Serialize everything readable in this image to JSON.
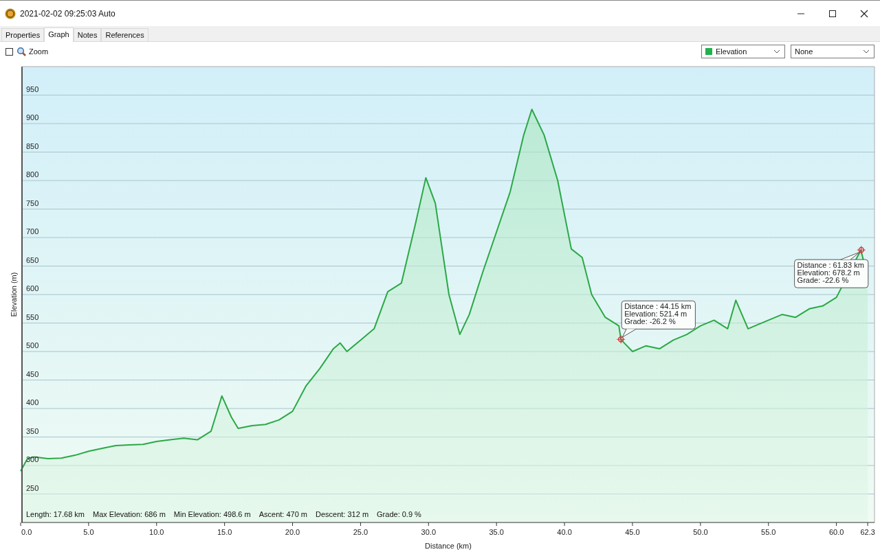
{
  "window": {
    "title": "2021-02-02 09:25:03 Auto"
  },
  "tabs": [
    {
      "label": "Properties",
      "selected": false
    },
    {
      "label": "Graph",
      "selected": true
    },
    {
      "label": "Notes",
      "selected": false
    },
    {
      "label": "References",
      "selected": false
    }
  ],
  "toolbar": {
    "zoom": {
      "label": "Zoom",
      "checked": false
    },
    "dropdowns": [
      {
        "value": "Elevation",
        "color": "#22b14c"
      },
      {
        "value": "None"
      }
    ]
  },
  "graph": {
    "stats": [
      "Length: 17.68 km",
      "Max Elevation: 686 m",
      "Min Elevation: 498.6 m",
      "Ascent: 470 m",
      "Descent: 312 m",
      "Grade: 0.9 %"
    ],
    "chart_data": {
      "type": "area",
      "xlabel": "Distance (km)",
      "ylabel": "Elevation (m)",
      "ylim": [
        200,
        1000
      ],
      "grid": true,
      "xlim": [
        0,
        62.8
      ],
      "xticks": [
        {
          "value": 0,
          "label": "0.0"
        },
        {
          "value": 5,
          "label": "5.0"
        },
        {
          "value": 10,
          "label": "10.0"
        },
        {
          "value": 15,
          "label": "15.0"
        },
        {
          "value": 20,
          "label": "20.0"
        },
        {
          "value": 25,
          "label": "25.0"
        },
        {
          "value": 30,
          "label": "30.0"
        },
        {
          "value": 35,
          "label": "35.0"
        },
        {
          "value": 40,
          "label": "40.0"
        },
        {
          "value": 45,
          "label": "45.0"
        },
        {
          "value": 50,
          "label": "50.0"
        },
        {
          "value": 55,
          "label": "55.0"
        },
        {
          "value": 60,
          "label": "60.0"
        },
        {
          "value": 62.3,
          "label": "62.3"
        }
      ],
      "yticks": [
        250,
        300,
        350,
        400,
        450,
        500,
        550,
        600,
        650,
        700,
        750,
        800,
        850,
        900,
        950
      ],
      "x": [
        0,
        0.5,
        1,
        2,
        3,
        4,
        5,
        6,
        7,
        8,
        9,
        10,
        11,
        12,
        13,
        14,
        14.8,
        15.5,
        16,
        17,
        18,
        19,
        20,
        21,
        22,
        23,
        23.5,
        24,
        25,
        26,
        27,
        28,
        29,
        29.8,
        30.5,
        31.5,
        32.3,
        33,
        34,
        35,
        36,
        37,
        37.6,
        38.5,
        39.5,
        40.5,
        41.3,
        42,
        43,
        44,
        44.15,
        45,
        46,
        47,
        48,
        49,
        50,
        51,
        52,
        52.6,
        53.5,
        54,
        55,
        56,
        57,
        58,
        59,
        60,
        61.8,
        62.3
      ],
      "series": [
        {
          "color": "#2aa845",
          "values": [
            290,
            312,
            315,
            312,
            313,
            318,
            325,
            330,
            335,
            336,
            337,
            342,
            345,
            348,
            345,
            360,
            422,
            385,
            365,
            370,
            372,
            380,
            395,
            440,
            470,
            505,
            515,
            500,
            520,
            540,
            605,
            620,
            720,
            805,
            760,
            600,
            530,
            565,
            640,
            710,
            780,
            880,
            925,
            880,
            800,
            680,
            665,
            600,
            560,
            545,
            521,
            500,
            510,
            505,
            520,
            530,
            545,
            555,
            540,
            590,
            540,
            545,
            555,
            565,
            560,
            575,
            580,
            595,
            678,
            630
          ]
        }
      ],
      "annotations": [
        {
          "x": 44.15,
          "y": 521.4,
          "text": "Distance : 44.15 km\nElevation: 521.4 m\nGrade: -26.2 %"
        },
        {
          "x": 61.83,
          "y": 678.2,
          "text": "Distance : 61.83 km\nElevation: 678.2 m\nGrade: -22.6 %"
        }
      ]
    }
  }
}
